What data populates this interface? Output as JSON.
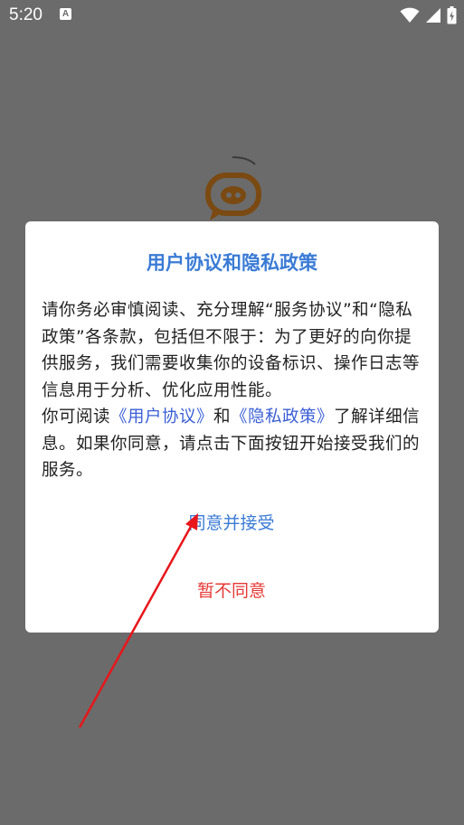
{
  "status_bar": {
    "time": "5:20",
    "notification_icon": "a-notification-icon",
    "wifi_icon": "wifi-icon",
    "signal_icon": "cell-signal-icon",
    "battery_icon": "battery-charging-icon"
  },
  "background": {
    "logo_icon": "chat-bubble-pig-logo-icon"
  },
  "dialog": {
    "title": "用户协议和隐私政策",
    "body_part1": "请你务必审慎阅读、充分理解“服务协议”和“隐私政策”各条款，包括但不限于：为了更好的向你提供服务，我们需要收集你的设备标识、操作日志等信息用于分析、优化应用性能。",
    "body_part2_prefix": "你可阅读",
    "user_agreement_link": "《用户协议》",
    "conjunction": "和",
    "privacy_policy_link": "《隐私政策》",
    "body_part2_suffix": "了解详细信息。如果你同意，请点击下面按钮开始接受我们的服务。",
    "agree_label": "同意并接受",
    "disagree_label": "暂不同意"
  },
  "colors": {
    "overlay": "#6b6b6b",
    "title_blue": "#3a7bd5",
    "link_blue": "#3a5fd5",
    "disagree_red": "#e53935",
    "annotation_arrow": "#e8161b",
    "logo_brown": "#7a4a12"
  }
}
